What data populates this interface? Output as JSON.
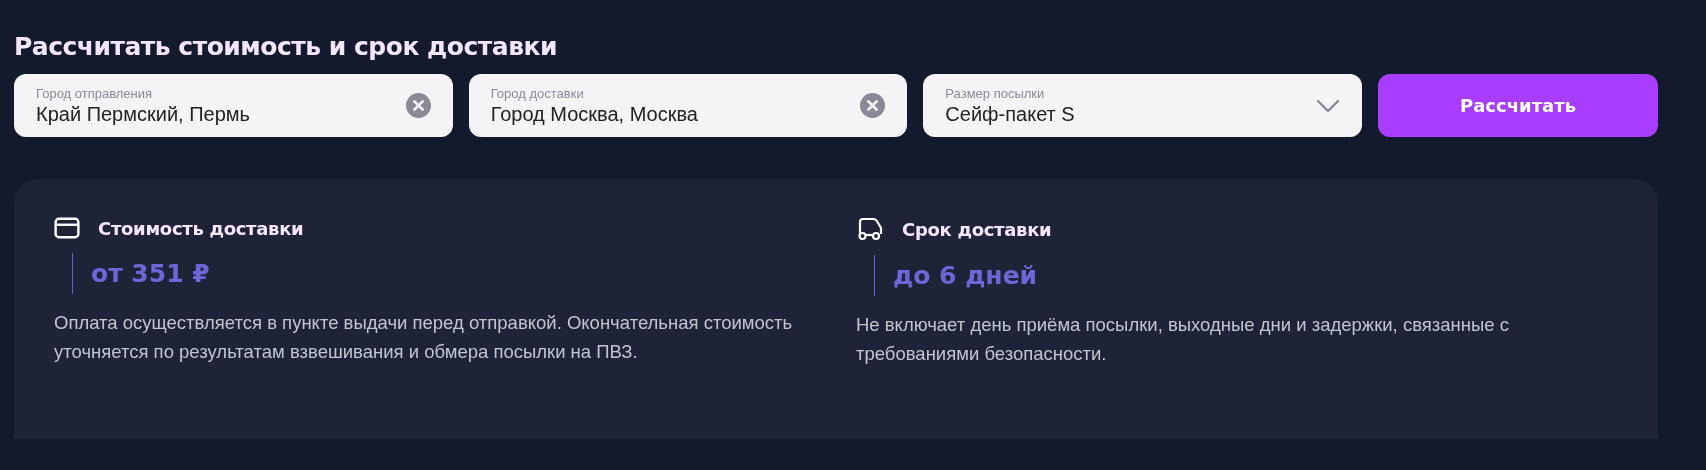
{
  "title": "Рассчитать стоимость и срок доставки",
  "fields": [
    {
      "kind": "text",
      "label": "Город отправления",
      "value": "Край Пермский, Пермь"
    },
    {
      "kind": "text",
      "label": "Город доставки",
      "value": "Город Москва, Москва"
    },
    {
      "kind": "select",
      "label": "Размер посылки",
      "value": "Сейф-пакет S"
    }
  ],
  "button": "Рассчитать",
  "results": [
    {
      "kind": "card",
      "heading": "Стоимость доставки",
      "value": "от 351 ₽",
      "note": "Оплата осуществляется в пункте выдачи перед отправкой. Окончательная стоимость уточняется по результатам взвешивания и обмера посылки на ПВЗ."
    },
    {
      "kind": "truck",
      "heading": "Срок доставки",
      "value": "до 6 дней",
      "note": "Не включает день приёма посылки, выходные дни и задержки, связанные с требованиями безопасности."
    }
  ]
}
